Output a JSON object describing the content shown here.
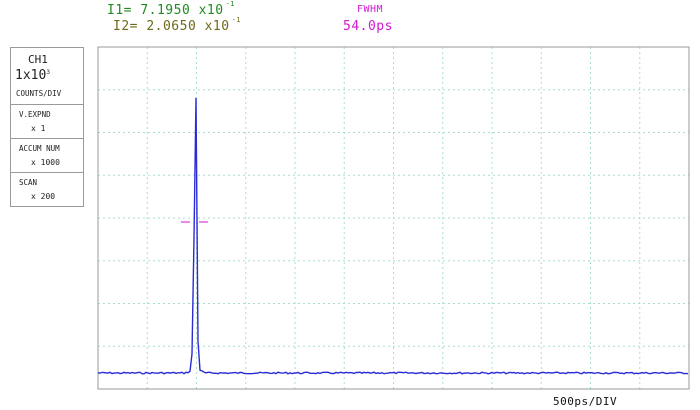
{
  "readouts": {
    "i1": {
      "label": "I1=",
      "mantissa": "7.1950",
      "times": "x10",
      "exponent": "-1"
    },
    "i2": {
      "label": "I2=",
      "mantissa": "2.0650",
      "times": "x10",
      "exponent": "-1"
    },
    "fwhm": {
      "label": "FWHM",
      "value": "54.0ps"
    }
  },
  "settings_panel": {
    "channel": "CH1",
    "scale_text": "1x10",
    "scale_exponent": "3",
    "scale_unit": "COUNTS/DIV",
    "v_expand": {
      "label": "V.EXPND",
      "value": "x 1"
    },
    "accum_num": {
      "label": "ACCUM NUM",
      "value": "x 1000"
    },
    "scan": {
      "label": "SCAN",
      "value": "x 200"
    }
  },
  "x_axis": {
    "scale_label": "500ps/DIV"
  },
  "colors": {
    "trace": "#2b2bd6",
    "grid": "#a6e0c8",
    "frame": "#9a9a9a",
    "i1_text": "#1f8a1f",
    "i2_text": "#6f6a1a",
    "fwhm_text": "#d21ad2"
  },
  "chart_data": {
    "type": "line",
    "xlabel": "",
    "ylabel": "",
    "x_per_div_ps": 500,
    "y_per_div_counts": 1000,
    "grid": true,
    "ylim_divisions": [
      0,
      8
    ],
    "peak_counts": 7195,
    "baseline_counts": 0,
    "fwhm_ps": 54.0,
    "series": [
      {
        "x_ps": [
          0,
          800,
          900,
          950,
          980,
          1000,
          1010,
          1020,
          1040,
          1060,
          1100,
          1200,
          5000
        ],
        "counts": [
          0,
          0,
          40,
          600,
          3500,
          6400,
          7195,
          6400,
          2800,
          600,
          60,
          0,
          0
        ]
      }
    ]
  }
}
